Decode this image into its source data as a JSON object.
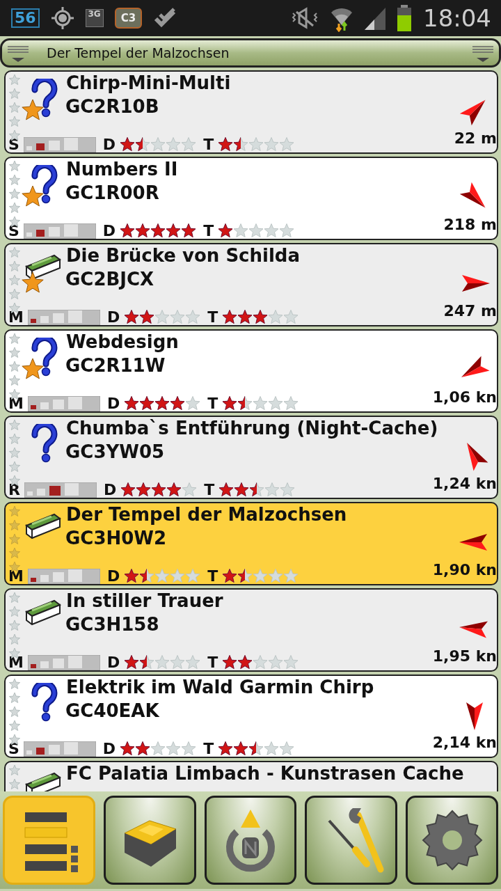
{
  "status_bar": {
    "notification_count": "56",
    "network_type": "3G",
    "app_label": "C3",
    "time": "18:04"
  },
  "header": {
    "title": "Der Tempel der Malzochsen"
  },
  "caches": [
    {
      "kind": "mystery",
      "starred": true,
      "selected": false,
      "name": "Chirp-Mini-Multi",
      "code": "GC2R10B",
      "distance": "22 m",
      "size": {
        "label": "S",
        "kind": "small"
      },
      "difficulty": {
        "label": "D",
        "stars": 1.5
      },
      "terrain": {
        "label": "T",
        "stars": 1.5
      }
    },
    {
      "kind": "mystery",
      "starred": true,
      "selected": false,
      "name": "Numbers II",
      "code": "GC1R00R",
      "distance": "218 m",
      "size": {
        "label": "S",
        "kind": "small"
      },
      "difficulty": {
        "label": "D",
        "stars": 5
      },
      "terrain": {
        "label": "T",
        "stars": 1
      }
    },
    {
      "kind": "traditional",
      "starred": true,
      "selected": false,
      "name": "Die Brücke von Schilda",
      "code": "GC2BJCX",
      "distance": "247 m",
      "size": {
        "label": "M",
        "kind": "micro"
      },
      "difficulty": {
        "label": "D",
        "stars": 2
      },
      "terrain": {
        "label": "T",
        "stars": 3
      }
    },
    {
      "kind": "mystery",
      "starred": true,
      "selected": false,
      "name": "Webdesign",
      "code": "GC2R11W",
      "distance": "1,06 kn",
      "size": {
        "label": "M",
        "kind": "micro"
      },
      "difficulty": {
        "label": "D",
        "stars": 4
      },
      "terrain": {
        "label": "T",
        "stars": 1.5
      }
    },
    {
      "kind": "mystery",
      "starred": false,
      "selected": false,
      "name": "Chumba`s Entführung (Night-Cache)",
      "code": "GC3YW05",
      "distance": "1,24 kn",
      "size": {
        "label": "R",
        "kind": "regular"
      },
      "difficulty": {
        "label": "D",
        "stars": 4
      },
      "terrain": {
        "label": "T",
        "stars": 2.5
      }
    },
    {
      "kind": "traditional",
      "starred": false,
      "selected": true,
      "name": "Der Tempel der Malzochsen",
      "code": "GC3H0W2",
      "distance": "1,90 kn",
      "size": {
        "label": "M",
        "kind": "micro"
      },
      "difficulty": {
        "label": "D",
        "stars": 1.5
      },
      "terrain": {
        "label": "T",
        "stars": 1.5
      }
    },
    {
      "kind": "traditional",
      "starred": false,
      "selected": false,
      "name": "In stiller Trauer",
      "code": "GC3H158",
      "distance": "1,95 kn",
      "size": {
        "label": "M",
        "kind": "micro"
      },
      "difficulty": {
        "label": "D",
        "stars": 1.5
      },
      "terrain": {
        "label": "T",
        "stars": 2
      }
    },
    {
      "kind": "mystery",
      "starred": false,
      "selected": false,
      "name": "Elektrik im Wald Garmin Chirp",
      "code": "GC40EAK",
      "distance": "2,14 kn",
      "size": {
        "label": "S",
        "kind": "small"
      },
      "difficulty": {
        "label": "D",
        "stars": 2
      },
      "terrain": {
        "label": "T",
        "stars": 2.5
      }
    },
    {
      "kind": "traditional",
      "starred": false,
      "selected": false,
      "name": "FC Palatia Limbach - Kunstrasen Cache"
    }
  ],
  "toolbar": [
    {
      "kind": "list",
      "selected": true
    },
    {
      "kind": "cache",
      "selected": false
    },
    {
      "kind": "compass",
      "selected": false
    },
    {
      "kind": "tools",
      "selected": false
    },
    {
      "kind": "settings",
      "selected": false
    }
  ]
}
